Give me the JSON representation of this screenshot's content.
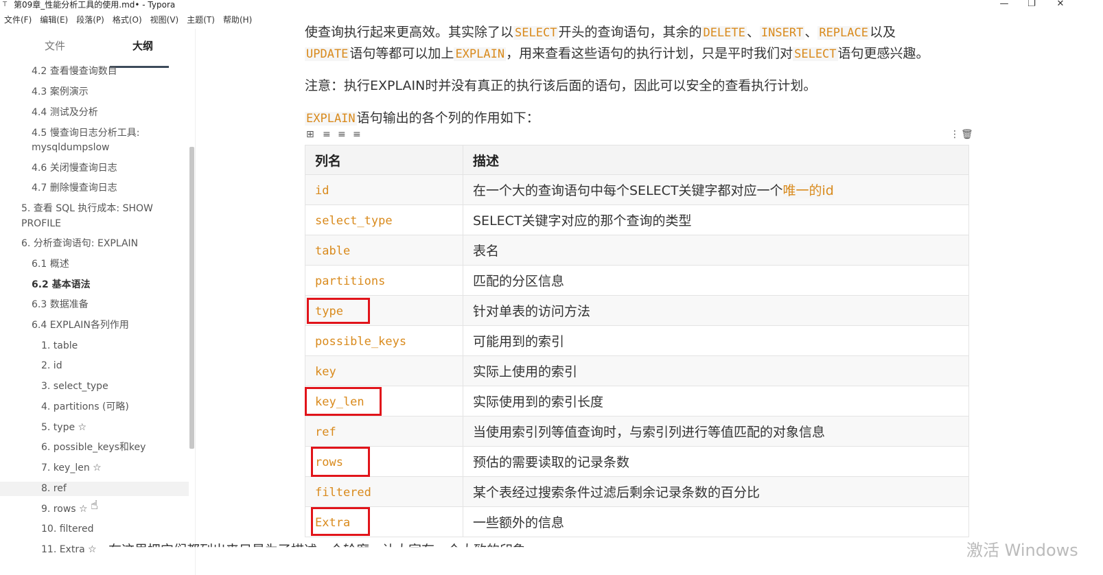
{
  "window": {
    "title": "第09章_性能分析工具的使用.md• - Typora",
    "icon": "typora-icon"
  },
  "menubar": [
    "文件(F)",
    "编辑(E)",
    "段落(P)",
    "格式(O)",
    "视图(V)",
    "主题(T)",
    "帮助(H)"
  ],
  "sidebar": {
    "tabs": {
      "files": "文件",
      "outline": "大纲"
    },
    "items": [
      "4.2 查看慢查询数目",
      "4.3 案例演示",
      "4.4 测试及分析",
      "4.5 慢查询日志分析工具:",
      "mysqldumpslow",
      "4.6 关闭慢查询日志",
      "4.7 删除慢查询日志",
      "5. 查看 SQL 执行成本: SHOW",
      "PROFILE",
      "6. 分析查询语句: EXPLAIN",
      "6.1 概述",
      "6.2 基本语法",
      "6.3 数据准备",
      "6.4 EXPLAIN各列作用",
      "1. table",
      "2. id",
      "3. select_type",
      "4. partitions (可略)",
      "5. type ☆",
      "6. possible_keys和key",
      "7. key_len ☆",
      "8. ref",
      "9. rows ☆",
      "10. filtered",
      "11. Extra ☆"
    ]
  },
  "content": {
    "p1_a": "使查询执行起来更高效。其实除了以",
    "p1_select": "SELECT",
    "p1_b": "开头的查询语句，其余的",
    "p1_delete": "DELETE",
    "p1_sep1": "、",
    "p1_insert": "INSERT",
    "p1_sep2": "、",
    "p1_replace": "REPLACE",
    "p1_c": "以及",
    "p2_update": "UPDATE",
    "p2_a": "语句等都可以加上",
    "p2_explain": "EXPLAIN",
    "p2_b": "，用来查看这些语句的执行计划，只是平时我们对",
    "p2_select": "SELECT",
    "p2_c": "语句更感兴趣。",
    "p3": "注意：执行EXPLAIN时并没有真正的执行该后面的语句，因此可以安全的查看执行计划。",
    "p4_explain": "EXPLAIN",
    "p4_a": "语句输出的各个列的作用如下：",
    "bottom": "在这里把它们都列出来只是为了描述一个轮廓，让大家有一个大致的印象。",
    "watermark": "激活 Windows"
  },
  "table": {
    "headers": [
      "列名",
      "描述"
    ],
    "rows": [
      {
        "name": "id",
        "desc": "在一个大的查询语句中每个SELECT关键字都对应一个",
        "desc_hl": "唯一的id"
      },
      {
        "name": "select_type",
        "desc": "SELECT关键字对应的那个查询的类型"
      },
      {
        "name": "table",
        "desc": "表名"
      },
      {
        "name": "partitions",
        "desc": "匹配的分区信息"
      },
      {
        "name": "type",
        "desc": "针对单表的访问方法"
      },
      {
        "name": "possible_keys",
        "desc": "可能用到的索引"
      },
      {
        "name": "key",
        "desc": "实际上使用的索引"
      },
      {
        "name": "key_len",
        "desc": "实际使用到的索引长度"
      },
      {
        "name": "ref",
        "desc": "当使用索引列等值查询时，与索引列进行等值匹配的对象信息"
      },
      {
        "name": "rows",
        "desc": "预估的需要读取的记录条数"
      },
      {
        "name": "filtered",
        "desc": "某个表经过搜索条件过滤后剩余记录条数的百分比"
      },
      {
        "name": "Extra",
        "desc": "一些额外的信息"
      }
    ]
  },
  "colors": {
    "code": "#d98a1c",
    "annotation_box": "#e1141a"
  }
}
